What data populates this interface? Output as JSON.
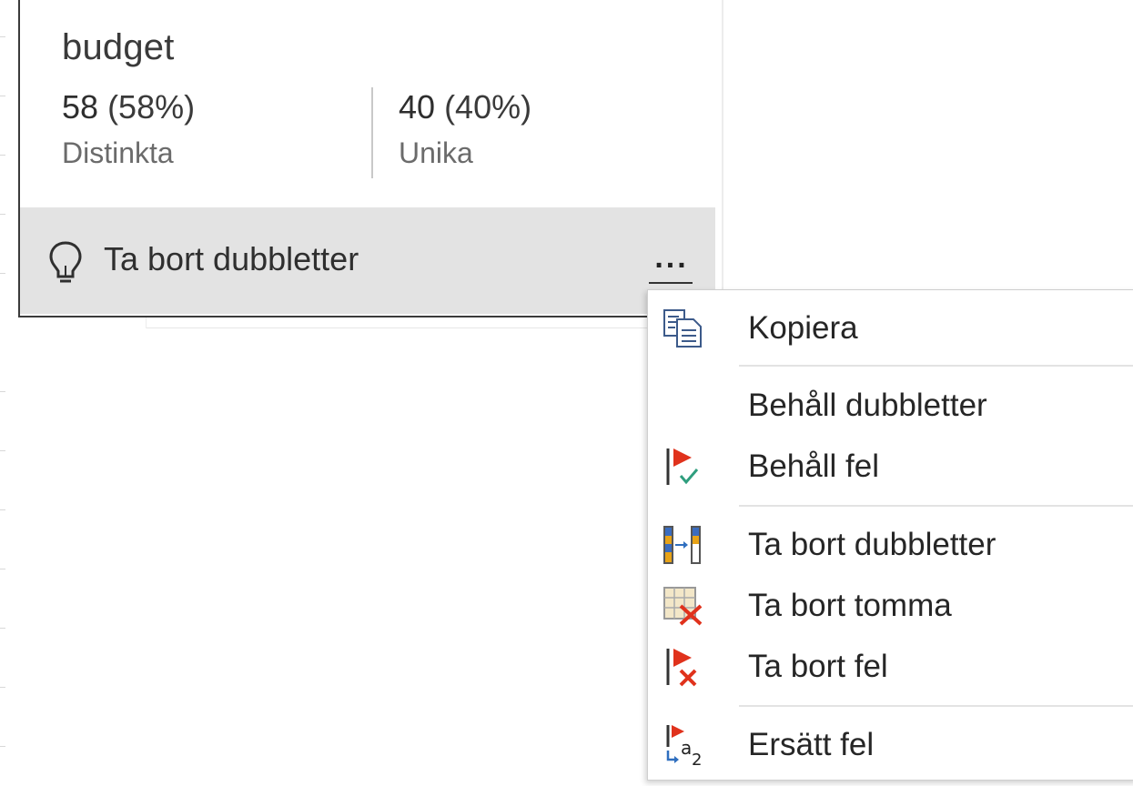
{
  "card": {
    "title": "budget",
    "stats": [
      {
        "value": "58",
        "percent": "(58%)",
        "label": "Distinkta"
      },
      {
        "value": "40",
        "percent": "(40%)",
        "label": "Unika"
      }
    ],
    "action": {
      "icon": "lightbulb-icon",
      "label": "Ta bort dubbletter",
      "more_label": "..."
    }
  },
  "menu": {
    "items": [
      {
        "label": "Kopiera",
        "icon": "copy-icon"
      },
      {
        "label": "Behåll dubbletter",
        "icon": ""
      },
      {
        "label": "Behåll fel",
        "icon": "keep-errors-icon"
      },
      {
        "label": "Ta bort dubbletter",
        "icon": "remove-duplicates-icon"
      },
      {
        "label": "Ta bort tomma",
        "icon": "remove-empty-icon"
      },
      {
        "label": "Ta bort fel",
        "icon": "remove-errors-icon"
      },
      {
        "label": "Ersätt fel",
        "icon": "replace-errors-icon"
      }
    ]
  },
  "colors": {
    "action_bar": "#e3e3e3",
    "flag_red": "#e0321c",
    "check_green": "#2f9e7e",
    "blue": "#2f6fbf",
    "orange": "#e8a317"
  }
}
